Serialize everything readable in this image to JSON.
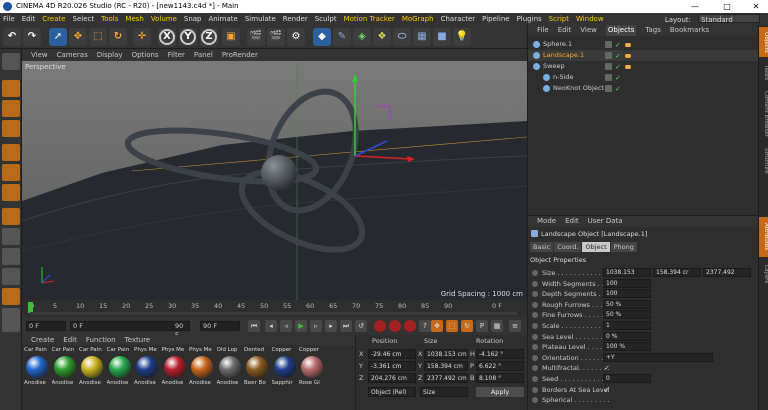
{
  "window": {
    "title": "CINEMA 4D R20.026 Studio (RC - R20) - [new1143.c4d *] - Main",
    "min": "—",
    "max": "□",
    "close": "✕"
  },
  "menu": [
    "File",
    "Edit",
    "Create",
    "Select",
    "Tools",
    "Mesh",
    "Volume",
    "Snap",
    "Animate",
    "Simulate",
    "Render",
    "Sculpt",
    "Motion Tracker",
    "MoGraph",
    "Character",
    "Pipeline",
    "Plugins",
    "Script",
    "Window"
  ],
  "layout": {
    "label": "Layout:",
    "value": "Standard"
  },
  "toolbar": {
    "x_axis": "X",
    "y_axis": "Y",
    "z_axis": "Z"
  },
  "viewport": {
    "menu": [
      "View",
      "Cameras",
      "Display",
      "Options",
      "Filter",
      "Panel",
      "ProRender"
    ],
    "camera_label": "Perspective",
    "grid_spacing": "Grid Spacing : 1000 cm"
  },
  "timeline": {
    "ticks": [
      "0",
      "5",
      "10",
      "15",
      "20",
      "25",
      "30",
      "35",
      "40",
      "45",
      "50",
      "55",
      "60",
      "65",
      "70",
      "75",
      "80",
      "85",
      "90"
    ],
    "end_label": "0 F"
  },
  "transport": {
    "current_frame": "0 F",
    "start_frame": "0 F",
    "end_frame": "90 F",
    "max_frame": "90 F"
  },
  "materials": {
    "menu": [
      "Create",
      "Edit",
      "Function",
      "Texture"
    ],
    "items": [
      {
        "top": "Car Pain",
        "bottom": "Anodise",
        "color": "#1f66c8"
      },
      {
        "top": "Car Pain",
        "bottom": "Anodise",
        "color": "#2e9e2e"
      },
      {
        "top": "Car Pain",
        "bottom": "Anodise",
        "color": "#c8b21f"
      },
      {
        "top": "Car Pain",
        "bottom": "Anodise",
        "color": "#27a84a"
      },
      {
        "top": "Phys Me",
        "bottom": "Anodise",
        "color": "#1d3d8a"
      },
      {
        "top": "Phys Me",
        "bottom": "Anodise",
        "color": "#b81f2b"
      },
      {
        "top": "Phys Me",
        "bottom": "Anodise",
        "color": "#c8671f"
      },
      {
        "top": "Old Lop",
        "bottom": "Anodise",
        "color": "#6b6b6b"
      },
      {
        "top": "Dented",
        "bottom": "Beer Bo",
        "color": "#8a5a1f"
      },
      {
        "top": "Copper",
        "bottom": "Sapphir",
        "color": "#1f3d8a"
      },
      {
        "top": "Copper",
        "bottom": "Rose Gl",
        "color": "#b86a6a"
      }
    ]
  },
  "coords": {
    "headers": {
      "position": "Position",
      "size": "Size",
      "rotation": "Rotation"
    },
    "rows": [
      {
        "axis": "X",
        "pos": "-29.46 cm",
        "size": "1038.153 cm",
        "rot_axis": "H",
        "rot": "-4.162 °"
      },
      {
        "axis": "Y",
        "pos": "-3.361 cm",
        "size": "158.394 cm",
        "rot_axis": "P",
        "rot": "6.622 °"
      },
      {
        "axis": "Z",
        "pos": "204.276 cm",
        "size": "2377.492 cm",
        "rot_axis": "B",
        "rot": "8.108 °"
      }
    ],
    "mode": "Object (Rel)",
    "size_mode": "Size",
    "apply": "Apply"
  },
  "objects": {
    "menu": [
      "File",
      "Edit",
      "View",
      "Objects",
      "Tags",
      "Bookmarks"
    ],
    "active_tab": "Objects",
    "items": [
      {
        "name": "Sphere.1",
        "selected": false,
        "indent": 0
      },
      {
        "name": "Landscape.1",
        "selected": true,
        "indent": 0
      },
      {
        "name": "Sweep",
        "selected": false,
        "indent": 0
      },
      {
        "name": "n-Side",
        "selected": false,
        "indent": 1
      },
      {
        "name": "NeoKnot Object",
        "selected": false,
        "indent": 1
      }
    ]
  },
  "side_tabs": [
    "Objects",
    "Takes",
    "Content Browser",
    "Structure",
    "Attributes",
    "Layers"
  ],
  "attributes": {
    "menu": [
      "Mode",
      "Edit",
      "User Data"
    ],
    "object_title": "Landscape Object [Landscape.1]",
    "tabs": [
      "Basic",
      "Coord.",
      "Object",
      "Phong"
    ],
    "active_tab": "Object",
    "section": "Object Properties",
    "props": [
      {
        "label": "Size . . . . . . . . . . . . .",
        "values": [
          "1038.153",
          "158.394 cr",
          "2377.492"
        ]
      },
      {
        "label": "Width Segments . . . . .",
        "values": [
          "100"
        ]
      },
      {
        "label": "Depth Segments . . . . .",
        "values": [
          "100"
        ]
      },
      {
        "label": "Rough Furrows . . . . .",
        "values": [
          "50 %"
        ]
      },
      {
        "label": "Fine Furrows . . . . . .",
        "values": [
          "50 %"
        ]
      },
      {
        "label": "Scale . . . . . . . . . . . .",
        "values": [
          "1"
        ]
      },
      {
        "label": "Sea Level . . . . . . . . .",
        "values": [
          "0 %"
        ]
      },
      {
        "label": "Plateau Level . . . . . .",
        "values": [
          "100 %"
        ]
      },
      {
        "label": "Orientation . . . . . . . .",
        "values": [
          "+Y"
        ]
      },
      {
        "label": "Multifractal. . . . . . . .",
        "check": "✓"
      },
      {
        "label": "Seed . . . . . . . . . . . .",
        "values": [
          "0"
        ]
      },
      {
        "label": "Borders At Sea Level",
        "check": "✓"
      },
      {
        "label": "Spherical . . . . . . . . .",
        "check": ""
      }
    ]
  }
}
